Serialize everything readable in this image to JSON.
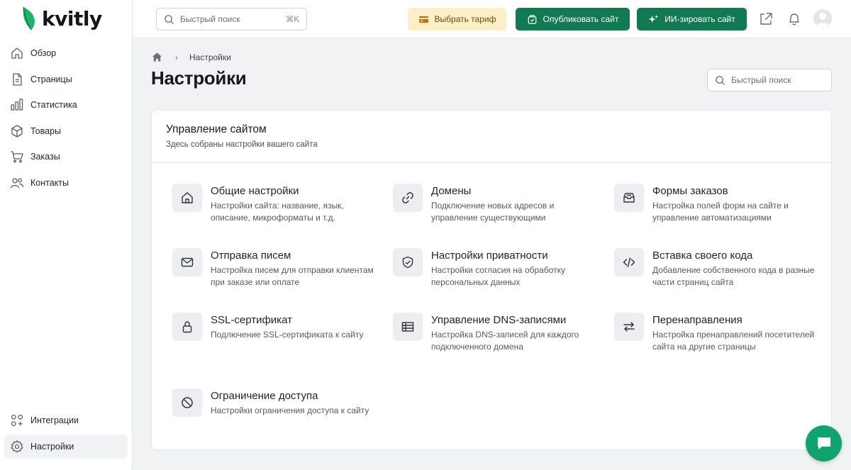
{
  "brand": {
    "name": "kvitly",
    "accent": "#127a52",
    "leaf_color": "#21b26b"
  },
  "sidebar": {
    "items": [
      {
        "label": "Обзор",
        "icon": "home-icon"
      },
      {
        "label": "Страницы",
        "icon": "page-icon"
      },
      {
        "label": "Статистика",
        "icon": "chart-icon"
      },
      {
        "label": "Товары",
        "icon": "box-icon"
      },
      {
        "label": "Заказы",
        "icon": "cart-icon"
      },
      {
        "label": "Контакты",
        "icon": "users-icon"
      }
    ],
    "bottom_items": [
      {
        "label": "Интеграции",
        "icon": "integrations-icon"
      },
      {
        "label": "Настройки",
        "icon": "gear-icon",
        "active": true
      }
    ]
  },
  "topbar": {
    "search_placeholder": "Быстрый поиск",
    "search_shortcut": "⌘K",
    "tariff_label": "Выбрать тариф",
    "publish_label": "Опубликовать сайт",
    "ai_label": "ИИ-зировать сайт"
  },
  "breadcrumb": {
    "current": "Настройки"
  },
  "page": {
    "title": "Настройки",
    "search_placeholder": "Быстрый поиск"
  },
  "card": {
    "title": "Управление сайтом",
    "subtitle": "Здесь собраны настройки вашего сайта",
    "items": [
      {
        "title": "Общие настройки",
        "desc": "Настройки сайта: название, язык, описание, микроформаты и т.д.",
        "icon": "home-icon"
      },
      {
        "title": "Домены",
        "desc": "Подключение новых адресов и управление существующими",
        "icon": "link-icon"
      },
      {
        "title": "Формы заказов",
        "desc": "Настройка полей форм на сайте и управление автоматизациями",
        "icon": "inbox-icon"
      },
      {
        "title": "Отправка писем",
        "desc": "Настройка писем для отправки клиентам при заказе или оплате",
        "icon": "mail-icon"
      },
      {
        "title": "Настройки приватности",
        "desc": "Настройки согласия на обработку персональных данных",
        "icon": "shield-check-icon"
      },
      {
        "title": "Вставка своего кода",
        "desc": "Добавление собственного кода в разные части страниц сайта",
        "icon": "code-icon"
      },
      {
        "title": "SSL-сертификат",
        "desc": "Подлючение SSL-сертификата к сайту",
        "icon": "lock-icon"
      },
      {
        "title": "Управление DNS-записями",
        "desc": "Настройка DNS-записей для каждого подключенного домена",
        "icon": "table-icon"
      },
      {
        "title": "Перенаправления",
        "desc": "Настройка пренаправлений посетителей сайта на другие страницы",
        "icon": "arrows-swap-icon"
      },
      {
        "title": "Ограничение доступа",
        "desc": "Настройки ограничения доступа к сайту",
        "icon": "block-icon"
      }
    ]
  }
}
